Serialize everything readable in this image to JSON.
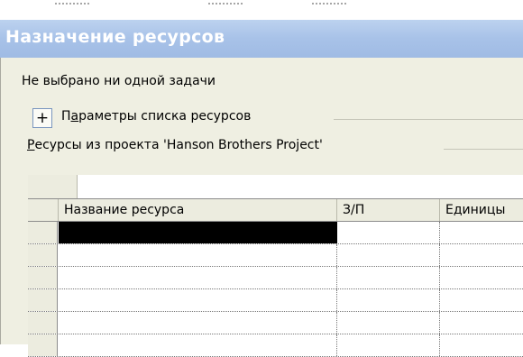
{
  "pane": {
    "title": "Назначение ресурсов",
    "no_task_text": "Не выбрано ни одной задачи",
    "params_toggle_symbol": "+",
    "params_label_pre": "П",
    "params_label_ul": "а",
    "params_label_post": "раметры списка ресурсов",
    "resources_label_ul": "Р",
    "resources_label_post": "есурсы из проекта 'Hanson Brothers Project'"
  },
  "grid": {
    "columns": [
      {
        "label": "Название ресурса"
      },
      {
        "label": "З/П"
      },
      {
        "label": "Единицы"
      }
    ],
    "rows": [
      {
        "name": "",
        "rt": "",
        "units": ""
      },
      {
        "name": "",
        "rt": "",
        "units": ""
      },
      {
        "name": "",
        "rt": "",
        "units": ""
      },
      {
        "name": "",
        "rt": "",
        "units": ""
      },
      {
        "name": "",
        "rt": "",
        "units": ""
      },
      {
        "name": "",
        "rt": "",
        "units": ""
      }
    ]
  },
  "colors": {
    "title_bar": "#a8c2e8",
    "pane_background": "#efefe2",
    "active_cell": "#000000"
  }
}
